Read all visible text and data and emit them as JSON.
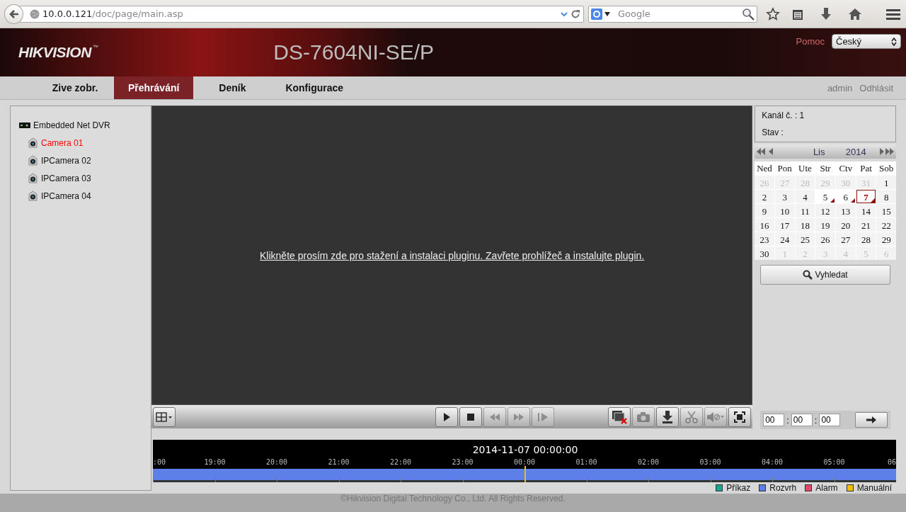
{
  "browser": {
    "url_host": "10.0.0.121",
    "url_path": "/doc/page/main.asp",
    "search_placeholder": "Google"
  },
  "header": {
    "logo": "HIKVISION",
    "logo_mark": "™",
    "title": "DS-7604NI-SE/P",
    "help": "Pomoc",
    "language": "Český"
  },
  "nav": {
    "tabs": [
      {
        "label": "Zive zobr.",
        "selected": false
      },
      {
        "label": "Přehrávání",
        "selected": true
      },
      {
        "label": "Deník",
        "selected": false
      },
      {
        "label": "Konfigurace",
        "selected": false
      }
    ],
    "user": "admin",
    "logout": "Odhlásit"
  },
  "tree": {
    "root": {
      "label": "Embedded Net DVR",
      "children": [
        {
          "label": "Camera 01",
          "selected": true
        },
        {
          "label": "IPCamera 02",
          "selected": false
        },
        {
          "label": "IPCamera 03",
          "selected": false
        },
        {
          "label": "IPCamera 04",
          "selected": false
        }
      ]
    }
  },
  "player": {
    "message": "Klikněte prosím zde pro stažení a instalaci pluginu. Zavřete prohlížeč a instalujte plugin.",
    "left_controls": [
      {
        "kind": "layout",
        "disabled": false
      }
    ],
    "playback_controls": [
      {
        "kind": "play",
        "disabled": false
      },
      {
        "kind": "stop",
        "disabled": false
      },
      {
        "kind": "slow",
        "disabled": true
      },
      {
        "kind": "fast",
        "disabled": true
      },
      {
        "kind": "frame",
        "disabled": true
      }
    ],
    "tool_controls": [
      {
        "kind": "stop-all",
        "disabled": false
      },
      {
        "kind": "capture",
        "disabled": true
      },
      {
        "kind": "download",
        "disabled": false
      },
      {
        "kind": "clip",
        "disabled": true
      },
      {
        "kind": "audio",
        "disabled": true
      },
      {
        "kind": "fullscreen",
        "disabled": false
      }
    ]
  },
  "channel": {
    "channel_label": "Kanál č. : 1",
    "status_label": "Stav :"
  },
  "calendar": {
    "month": "Lis",
    "year": "2014",
    "weekdays": [
      "Ned",
      "Pon",
      "Ute",
      "Str",
      "Ctv",
      "Pat",
      "Sob"
    ],
    "days": [
      {
        "day": "26",
        "in_month": false,
        "recorded": false,
        "selected": false
      },
      {
        "day": "27",
        "in_month": false,
        "recorded": false,
        "selected": false
      },
      {
        "day": "28",
        "in_month": false,
        "recorded": false,
        "selected": false
      },
      {
        "day": "29",
        "in_month": false,
        "recorded": false,
        "selected": false
      },
      {
        "day": "30",
        "in_month": false,
        "recorded": false,
        "selected": false
      },
      {
        "day": "31",
        "in_month": false,
        "recorded": false,
        "selected": false
      },
      {
        "day": "1",
        "in_month": true,
        "recorded": false,
        "selected": false
      },
      {
        "day": "2",
        "in_month": true,
        "recorded": false,
        "selected": false
      },
      {
        "day": "3",
        "in_month": true,
        "recorded": false,
        "selected": false
      },
      {
        "day": "4",
        "in_month": true,
        "recorded": false,
        "selected": false
      },
      {
        "day": "5",
        "in_month": true,
        "recorded": true,
        "selected": false
      },
      {
        "day": "6",
        "in_month": true,
        "recorded": true,
        "selected": false
      },
      {
        "day": "7",
        "in_month": true,
        "recorded": true,
        "selected": true
      },
      {
        "day": "8",
        "in_month": true,
        "recorded": false,
        "selected": false
      },
      {
        "day": "9",
        "in_month": true,
        "recorded": false,
        "selected": false
      },
      {
        "day": "10",
        "in_month": true,
        "recorded": false,
        "selected": false
      },
      {
        "day": "11",
        "in_month": true,
        "recorded": false,
        "selected": false
      },
      {
        "day": "12",
        "in_month": true,
        "recorded": false,
        "selected": false
      },
      {
        "day": "13",
        "in_month": true,
        "recorded": false,
        "selected": false
      },
      {
        "day": "14",
        "in_month": true,
        "recorded": false,
        "selected": false
      },
      {
        "day": "15",
        "in_month": true,
        "recorded": false,
        "selected": false
      },
      {
        "day": "16",
        "in_month": true,
        "recorded": false,
        "selected": false
      },
      {
        "day": "17",
        "in_month": true,
        "recorded": false,
        "selected": false
      },
      {
        "day": "18",
        "in_month": true,
        "recorded": false,
        "selected": false
      },
      {
        "day": "19",
        "in_month": true,
        "recorded": false,
        "selected": false
      },
      {
        "day": "20",
        "in_month": true,
        "recorded": false,
        "selected": false
      },
      {
        "day": "21",
        "in_month": true,
        "recorded": false,
        "selected": false
      },
      {
        "day": "22",
        "in_month": true,
        "recorded": false,
        "selected": false
      },
      {
        "day": "23",
        "in_month": true,
        "recorded": false,
        "selected": false
      },
      {
        "day": "24",
        "in_month": true,
        "recorded": false,
        "selected": false
      },
      {
        "day": "25",
        "in_month": true,
        "recorded": false,
        "selected": false
      },
      {
        "day": "26",
        "in_month": true,
        "recorded": false,
        "selected": false
      },
      {
        "day": "27",
        "in_month": true,
        "recorded": false,
        "selected": false
      },
      {
        "day": "28",
        "in_month": true,
        "recorded": false,
        "selected": false
      },
      {
        "day": "29",
        "in_month": true,
        "recorded": false,
        "selected": false
      },
      {
        "day": "30",
        "in_month": true,
        "recorded": false,
        "selected": false
      },
      {
        "day": "1",
        "in_month": false,
        "recorded": false,
        "selected": false
      },
      {
        "day": "2",
        "in_month": false,
        "recorded": false,
        "selected": false
      },
      {
        "day": "3",
        "in_month": false,
        "recorded": false,
        "selected": false
      },
      {
        "day": "4",
        "in_month": false,
        "recorded": false,
        "selected": false
      },
      {
        "day": "5",
        "in_month": false,
        "recorded": false,
        "selected": false
      },
      {
        "day": "6",
        "in_month": false,
        "recorded": false,
        "selected": false
      }
    ],
    "search_button": "Vyhledat"
  },
  "time_inputs": {
    "hours": "00",
    "minutes": "00",
    "seconds": "00",
    "separators": [
      ":",
      ":"
    ]
  },
  "timeline": {
    "current_time": "2014-11-07 00:00:00",
    "labels": [
      ":00",
      "19:00",
      "20:00",
      "21:00",
      "22:00",
      "23:00",
      "00:00",
      "01:00",
      "02:00",
      "03:00",
      "04:00",
      "05:00",
      "06"
    ],
    "legend": [
      {
        "label": "Příkaz",
        "color": "#14a88c"
      },
      {
        "label": "Rozvrh",
        "color": "#5b7fe0"
      },
      {
        "label": "Alarm",
        "color": "#e0466e"
      },
      {
        "label": "Manuální",
        "color": "#f0c000"
      }
    ]
  },
  "footer": "©Hikvision Digital Technology Co., Ltd. All Rights Reserved."
}
